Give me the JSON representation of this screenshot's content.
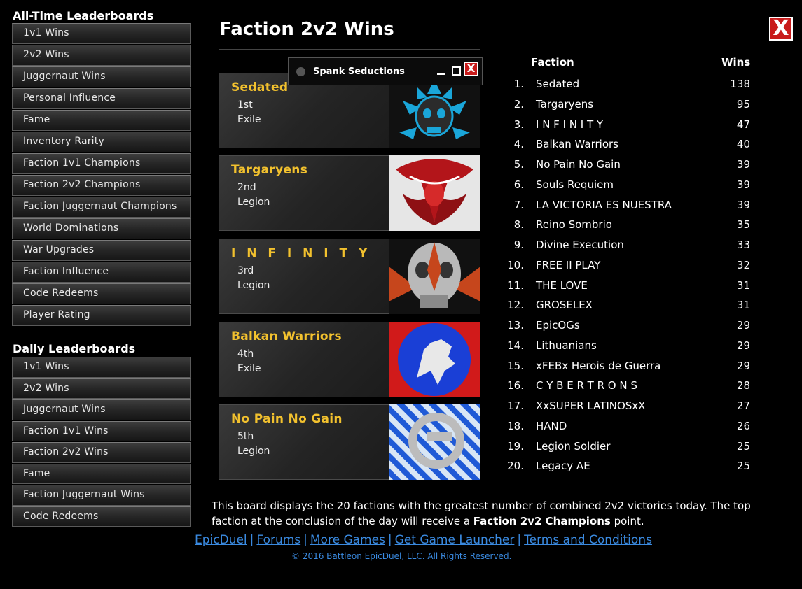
{
  "sidebar": {
    "alltime_title": "All-Time Leaderboards",
    "alltime_items": [
      "1v1 Wins",
      "2v2 Wins",
      "Juggernaut Wins",
      "Personal Influence",
      "Fame",
      "Inventory Rarity",
      "Faction 1v1 Champions",
      "Faction 2v2 Champions",
      "Faction Juggernaut Champions",
      "World Dominations",
      "War Upgrades",
      "Faction Influence",
      "Code Redeems",
      "Player Rating"
    ],
    "daily_title": "Daily Leaderboards",
    "daily_items": [
      "1v1 Wins",
      "2v2 Wins",
      "Juggernaut Wins",
      "Faction 1v1 Wins",
      "Faction 2v2 Wins",
      "Fame",
      "Faction Juggernaut Wins",
      "Code Redeems"
    ]
  },
  "main": {
    "title": "Faction 2v2 Wins",
    "close_label": "X"
  },
  "popup": {
    "title": "Spank Seductions",
    "close_label": "X"
  },
  "top_cards": [
    {
      "name": "Sedated",
      "rank": "1st",
      "type": "Exile",
      "icon": "cyan-skull-emblem"
    },
    {
      "name": "Targaryens",
      "rank": "2nd",
      "type": "Legion",
      "icon": "red-dragon-emblem"
    },
    {
      "name": "I N F I N I T Y",
      "rank": "3rd",
      "type": "Legion",
      "icon": "grey-skull-emblem"
    },
    {
      "name": "Balkan Warriors",
      "rank": "4th",
      "type": "Exile",
      "icon": "blue-lion-emblem"
    },
    {
      "name": "No Pain No Gain",
      "rank": "5th",
      "type": "Legion",
      "icon": "blue-striped-emblem"
    }
  ],
  "table": {
    "col_faction": "Faction",
    "col_wins": "Wins",
    "rows": [
      {
        "rank": "1.",
        "name": "Sedated",
        "wins": "138"
      },
      {
        "rank": "2.",
        "name": "Targaryens",
        "wins": "95"
      },
      {
        "rank": "3.",
        "name": "I N F I N I T Y",
        "wins": "47"
      },
      {
        "rank": "4.",
        "name": "Balkan Warriors",
        "wins": "40"
      },
      {
        "rank": "5.",
        "name": "No Pain No Gain",
        "wins": "39"
      },
      {
        "rank": "6.",
        "name": "Souls Requiem",
        "wins": "39"
      },
      {
        "rank": "7.",
        "name": "LA VICTORIA ES NUESTRA",
        "wins": "39"
      },
      {
        "rank": "8.",
        "name": "Reino Sombrio",
        "wins": "35"
      },
      {
        "rank": "9.",
        "name": "Divine Execution",
        "wins": "33"
      },
      {
        "rank": "10.",
        "name": "FREE II PLAY",
        "wins": "32"
      },
      {
        "rank": "11.",
        "name": "THE LOVE",
        "wins": "31"
      },
      {
        "rank": "12.",
        "name": "GROSELEX",
        "wins": "31"
      },
      {
        "rank": "13.",
        "name": "EpicOGs",
        "wins": "29"
      },
      {
        "rank": "14.",
        "name": "Lithuanians",
        "wins": "29"
      },
      {
        "rank": "15.",
        "name": "xFEBx Herois de Guerra",
        "wins": "29"
      },
      {
        "rank": "16.",
        "name": "C Y B E R T R O N S",
        "wins": "28"
      },
      {
        "rank": "17.",
        "name": "XxSUPER LATINOSxX",
        "wins": "27"
      },
      {
        "rank": "18.",
        "name": "HAND",
        "wins": "26"
      },
      {
        "rank": "19.",
        "name": "Legion Soldier",
        "wins": "25"
      },
      {
        "rank": "20.",
        "name": "Legacy AE",
        "wins": "25"
      }
    ]
  },
  "description": {
    "text_before": "This board displays the 20 factions with the greatest number of combined 2v2 victories today. The top faction at the conclusion of the day will receive a ",
    "bold": "Faction 2v2 Champions",
    "text_after": " point."
  },
  "footer": {
    "links": [
      "EpicDuel",
      "Forums",
      "More Games",
      "Get Game Launcher",
      "Terms and Conditions"
    ],
    "copyright_prefix": "© 2016 ",
    "copyright_link": "Battleon EpicDuel, LLC",
    "copyright_suffix": ". All Rights Reserved."
  },
  "colors": {
    "accent_gold": "#f2c12e",
    "link_blue": "#3a8ae0",
    "close_red": "#c81b1b"
  }
}
